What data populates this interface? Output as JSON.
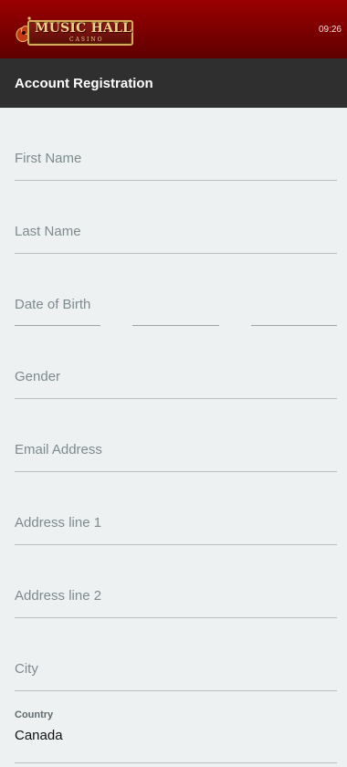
{
  "header": {
    "logo_title": "MUSIC HALL",
    "logo_subtitle": "CASINO",
    "time": "09:26"
  },
  "page": {
    "title": "Account Registration"
  },
  "form": {
    "first_name_placeholder": "First Name",
    "last_name_placeholder": "Last Name",
    "dob_placeholder": "Date of Birth",
    "gender_placeholder": "Gender",
    "email_placeholder": "Email Address",
    "address1_placeholder": "Address line 1",
    "address2_placeholder": "Address line 2",
    "city_placeholder": "City",
    "country_label": "Country",
    "country_value": "Canada"
  },
  "colors": {
    "header_red": "#7a0000",
    "title_bar": "#2f2f2f",
    "background": "#eef1f1",
    "placeholder": "#7d8b8f"
  }
}
